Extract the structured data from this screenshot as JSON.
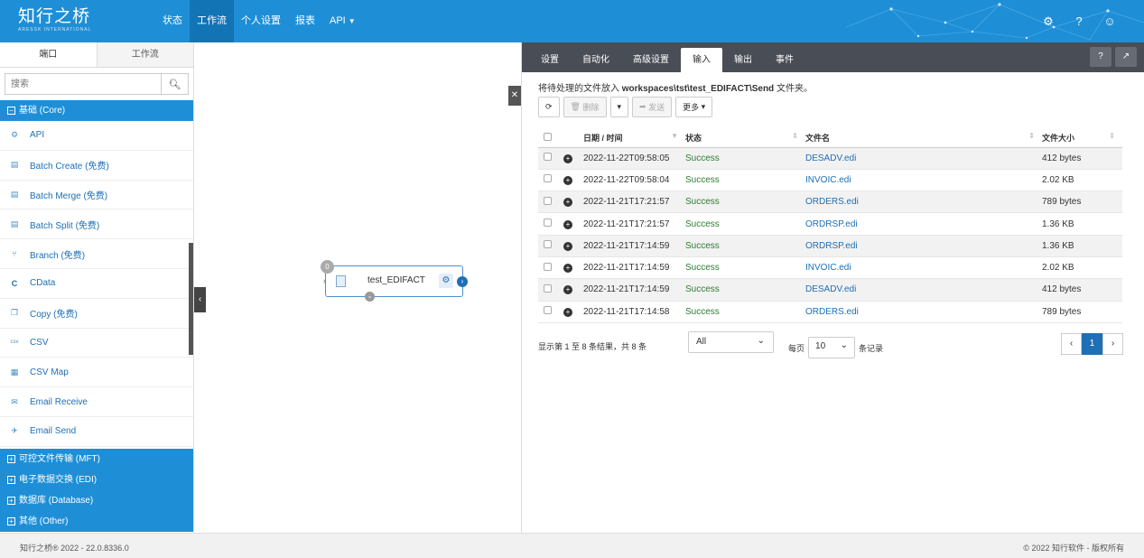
{
  "header": {
    "logo_main": "知行之桥",
    "logo_sub": "ARESSK INTERNATIONAL",
    "nav": [
      "状态",
      "工作流",
      "个人设置",
      "报表",
      "API"
    ],
    "active_nav": "工作流",
    "icons": [
      "gear-icon",
      "help-icon",
      "user-icon"
    ]
  },
  "sidebar": {
    "tabs": [
      "端口",
      "工作流"
    ],
    "search_placeholder": "搜索",
    "category_open": "基础 (Core)",
    "items": [
      {
        "label": "API",
        "icon": "api-icon"
      },
      {
        "label": "Batch Create (免费)",
        "icon": "batch-create-icon"
      },
      {
        "label": "Batch Merge (免费)",
        "icon": "batch-merge-icon"
      },
      {
        "label": "Batch Split (免费)",
        "icon": "batch-split-icon"
      },
      {
        "label": "Branch (免费)",
        "icon": "branch-icon"
      },
      {
        "label": "CData",
        "icon": "cdata-icon"
      },
      {
        "label": "Copy (免费)",
        "icon": "copy-icon"
      },
      {
        "label": "CSV",
        "icon": "csv-icon"
      },
      {
        "label": "CSV Map",
        "icon": "csv-map-icon"
      },
      {
        "label": "Email Receive",
        "icon": "email-receive-icon"
      },
      {
        "label": "Email Send",
        "icon": "email-send-icon"
      }
    ],
    "categories_closed": [
      "可控文件传输 (MFT)",
      "电子数据交换 (EDI)",
      "数据库 (Database)",
      "其他 (Other)"
    ]
  },
  "canvas": {
    "node_label": "test_EDIFACT",
    "node_badge": "0"
  },
  "panel": {
    "tabs": [
      "设置",
      "自动化",
      "高级设置",
      "输入",
      "输出",
      "事件"
    ],
    "active_tab": "输入",
    "desc_prefix": "将待处理的文件放入",
    "desc_path": "workspaces\\tst\\test_EDIFACT\\Send",
    "desc_suffix": "文件夹。",
    "toolbar": {
      "delete": "删除",
      "send": "发送",
      "more": "更多"
    },
    "columns": [
      "日期 / 时间",
      "状态",
      "文件名",
      "文件大小"
    ],
    "rows": [
      {
        "date": "2022-11-22T09:58:05",
        "status": "Success",
        "file": "DESADV.edi",
        "size": "412 bytes"
      },
      {
        "date": "2022-11-22T09:58:04",
        "status": "Success",
        "file": "INVOIC.edi",
        "size": "2.02 KB"
      },
      {
        "date": "2022-11-21T17:21:57",
        "status": "Success",
        "file": "ORDERS.edi",
        "size": "789 bytes"
      },
      {
        "date": "2022-11-21T17:21:57",
        "status": "Success",
        "file": "ORDRSP.edi",
        "size": "1.36 KB"
      },
      {
        "date": "2022-11-21T17:14:59",
        "status": "Success",
        "file": "ORDRSP.edi",
        "size": "1.36 KB"
      },
      {
        "date": "2022-11-21T17:14:59",
        "status": "Success",
        "file": "INVOIC.edi",
        "size": "2.02 KB"
      },
      {
        "date": "2022-11-21T17:14:59",
        "status": "Success",
        "file": "DESADV.edi",
        "size": "412 bytes"
      },
      {
        "date": "2022-11-21T17:14:58",
        "status": "Success",
        "file": "ORDERS.edi",
        "size": "789 bytes"
      }
    ],
    "pager_info": "显示第 1 至 8 条结果，共 8 条",
    "filter_value": "All",
    "per_page_prefix": "每页",
    "per_page_value": "10",
    "per_page_suffix": "条记录",
    "current_page": "1"
  },
  "footer": {
    "left": "知行之桥® 2022 - 22.0.8336.0",
    "right": "© 2022 知行软件 - 版权所有"
  }
}
